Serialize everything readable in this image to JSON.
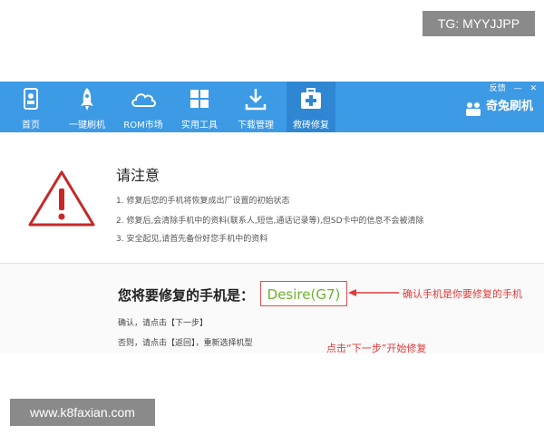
{
  "watermark_top": "TG: MYYJJPP",
  "watermark_bottom": "www.k8faxian.com",
  "toolbar": {
    "items": [
      {
        "label": "首页",
        "icon": "home-icon"
      },
      {
        "label": "一键刷机",
        "icon": "rocket-icon"
      },
      {
        "label": "ROM市场",
        "icon": "cloud-icon"
      },
      {
        "label": "实用工具",
        "icon": "grid-icon"
      },
      {
        "label": "下载管理",
        "icon": "download-icon"
      },
      {
        "label": "救砖修复",
        "icon": "medkit-icon"
      }
    ],
    "active_index": 5,
    "window_controls": [
      "反馈",
      "—",
      "✕"
    ],
    "brand": "奇兔刷机"
  },
  "notice": {
    "title": "请注意",
    "lines": [
      "1. 修复后您的手机将恢复成出厂设置的初始状态",
      "2. 修复后,会清除手机中的资料(联系人,短信,通话记录等),但SD卡中的信息不会被清除",
      "3. 安全起见,请首先备份好您手机中的资料"
    ]
  },
  "repair": {
    "question": "您将要修复的手机是：",
    "model": "Desire(G7)",
    "confirm_hint": "确认，请点击【下一步】",
    "back_hint": "否则，请点击【返回】，重新选择机型"
  },
  "annotations": {
    "confirm_note": "确认手机是你要修复的手机",
    "next_note": "点击“下一步”开始修复"
  },
  "colors": {
    "toolbar_blue": "#3d9ae4",
    "warning_red": "#c62828",
    "model_green": "#6cb12f",
    "note_red": "#e03a3a"
  }
}
